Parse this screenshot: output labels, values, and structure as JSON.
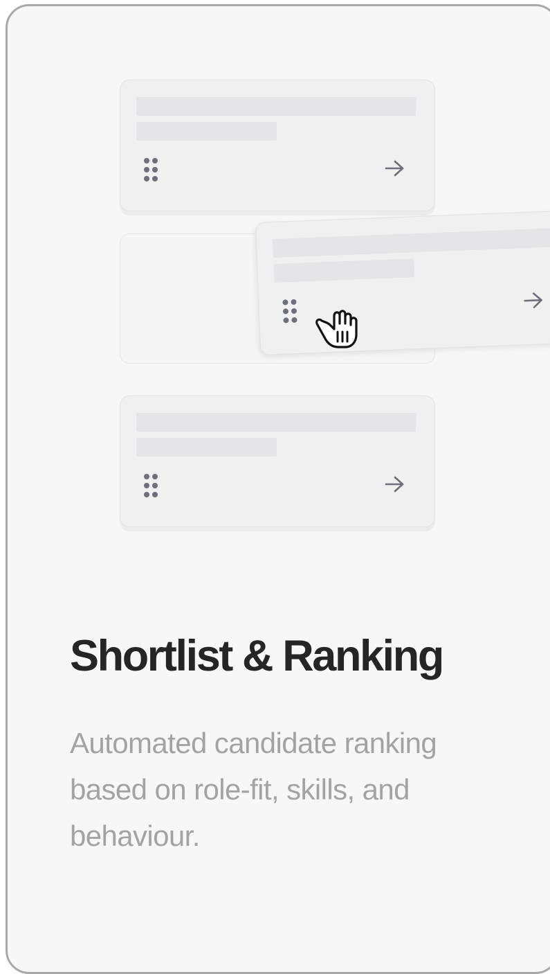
{
  "feature": {
    "title": "Shortlist & Ranking",
    "description": "Automated candidate ranking based on role-fit, skills, and behaviour."
  },
  "illustration": {
    "cards": [
      {
        "state": "resting",
        "handle_icon": "drag-handle-icon",
        "action_icon": "arrow-right-icon"
      },
      {
        "state": "dragging",
        "handle_icon": "drag-handle-icon",
        "action_icon": "arrow-right-icon"
      },
      {
        "state": "resting",
        "handle_icon": "drag-handle-icon",
        "action_icon": "arrow-right-icon"
      }
    ],
    "cursor_icon": "grab-hand-icon"
  },
  "colors": {
    "card_background": "#f7f7f7",
    "card_border": "#a9a9a9",
    "title": "#252525",
    "description": "#a3a3a3",
    "skeleton_line": "#e5e5e8",
    "icon": "#6e6f7b"
  }
}
